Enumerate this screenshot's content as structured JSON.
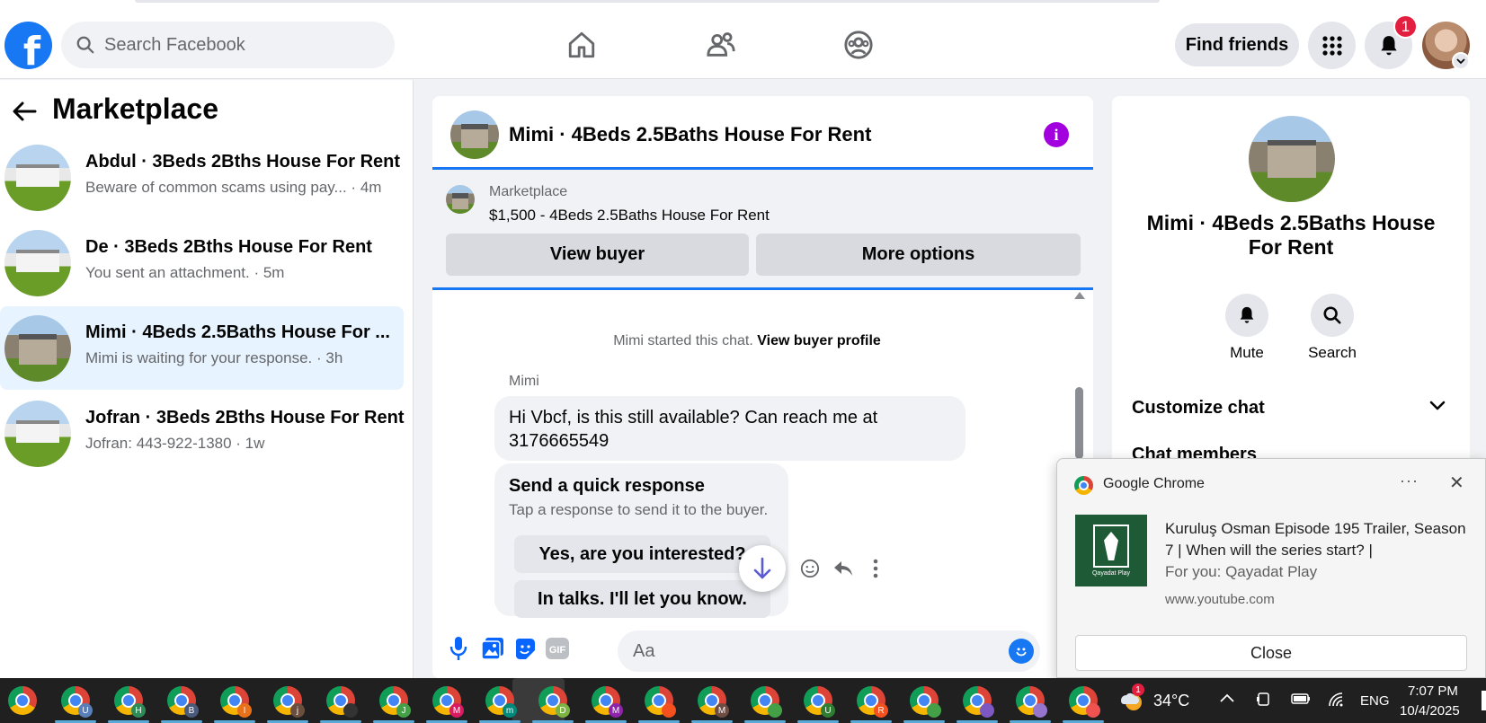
{
  "topnav": {
    "logo": "f",
    "search_placeholder": "Search Facebook",
    "find_friends": "Find friends",
    "notif_count": "1"
  },
  "sidebar": {
    "title": "Marketplace",
    "conversations": [
      {
        "name": "Abdul · 3Beds 2Bths House For Rent",
        "preview": "Beware of common scams using pay...",
        "time": "4m",
        "active": false
      },
      {
        "name": "De · 3Beds 2Bths House For Rent",
        "preview": "You sent an attachment.",
        "time": "5m",
        "active": false
      },
      {
        "name": "Mimi · 4Beds 2.5Baths House For ...",
        "preview": "Mimi is waiting for your response.",
        "time": "3h",
        "active": true
      },
      {
        "name": "Jofran · 3Beds 2Bths House For Rent",
        "preview": "Jofran: 443-922-1380",
        "time": "1w",
        "active": false
      }
    ]
  },
  "chat": {
    "title": "Mimi · 4Beds 2.5Baths House For Rent",
    "listing_label": "Marketplace",
    "listing_price": "$1,500 - 4Beds 2.5Baths House For Rent",
    "view_buyer": "View buyer",
    "more_options": "More options",
    "started_text": "Mimi started this chat.",
    "view_buyer_profile": "View buyer profile",
    "sender": "Mimi",
    "message": "Hi Vbcf, is this still available? Can reach me at 3176665549",
    "quick_title": "Send a quick response",
    "quick_sub": "Tap a response to send it to the buyer.",
    "quick_1": "Yes, are you interested?",
    "quick_2": "In talks. I'll let you know.",
    "input_placeholder": "Aa",
    "gif_label": "GIF"
  },
  "rpanel": {
    "title": "Mimi · 4Beds 2.5Baths House For Rent",
    "mute": "Mute",
    "search": "Search",
    "customize": "Customize chat",
    "chat_members": "Chat members"
  },
  "notification": {
    "app": "Google Chrome",
    "dots": "···",
    "headline": "Kuruluş Osman Episode 195 Trailer, Season 7 | When will the series start? |",
    "for_you": "For you: Qayadat Play",
    "site": "www.youtube.com",
    "close": "Close",
    "brand": "Qayadat Play"
  },
  "taskbar": {
    "apps": [
      {
        "letter": "",
        "color": ""
      },
      {
        "letter": "U",
        "color": "#5a7fb8"
      },
      {
        "letter": "H",
        "color": "#2e8b57"
      },
      {
        "letter": "B",
        "color": "#4a5a7a"
      },
      {
        "letter": "I",
        "color": "#e8711a"
      },
      {
        "letter": "j",
        "color": "#6b4e3d"
      },
      {
        "letter": "",
        "color": "#333333"
      },
      {
        "letter": "J",
        "color": "#43a047"
      },
      {
        "letter": "M",
        "color": "#d81b60"
      },
      {
        "letter": "m",
        "color": "#00897b"
      },
      {
        "letter": "D",
        "color": "#7cb342"
      },
      {
        "letter": "M",
        "color": "#8e24aa"
      },
      {
        "letter": "",
        "color": "#f4511e"
      },
      {
        "letter": "M",
        "color": "#6d4c41"
      },
      {
        "letter": "",
        "color": "#43a047"
      },
      {
        "letter": "U",
        "color": "#2e7d32"
      },
      {
        "letter": "R",
        "color": "#f4511e"
      },
      {
        "letter": "",
        "color": "#43a047"
      },
      {
        "letter": "",
        "color": "#7e57c2"
      },
      {
        "letter": "",
        "color": "#9575cd"
      },
      {
        "letter": "",
        "color": "#ef5350"
      }
    ],
    "weather_badge": "1",
    "temperature": "34°C",
    "language": "ENG",
    "time": "7:07 PM",
    "date": "10/4/2025"
  }
}
